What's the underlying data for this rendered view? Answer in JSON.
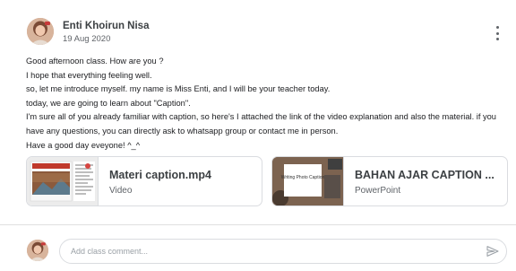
{
  "post": {
    "author": "Enti Khoirun Nisa",
    "date": "19 Aug 2020",
    "menu_icon": "more-vert-icon",
    "lines": [
      "Good afternoon class. How are you ?",
      "I hope that everything feeling well.",
      "so, let me introduce myself. my name is Miss Enti, and I will be your teacher today.",
      "today, we are going to learn about \"Caption\".",
      "I'm sure all of you already familiar with caption, so here's I attached the link of the video explanation and also the material. if you have any questions, you can directly ask to whatsapp group or contact me in person.",
      "Have a good day eveyone! ^_^"
    ]
  },
  "attachments": [
    {
      "title": "Materi caption.mp4",
      "type": "Video"
    },
    {
      "title": "BAHAN AJAR CAPTION ...",
      "type": "PowerPoint",
      "thumb_text": "Writing Photo Caption"
    }
  ],
  "comment": {
    "placeholder": "Add class comment...",
    "send_icon": "send-icon"
  }
}
